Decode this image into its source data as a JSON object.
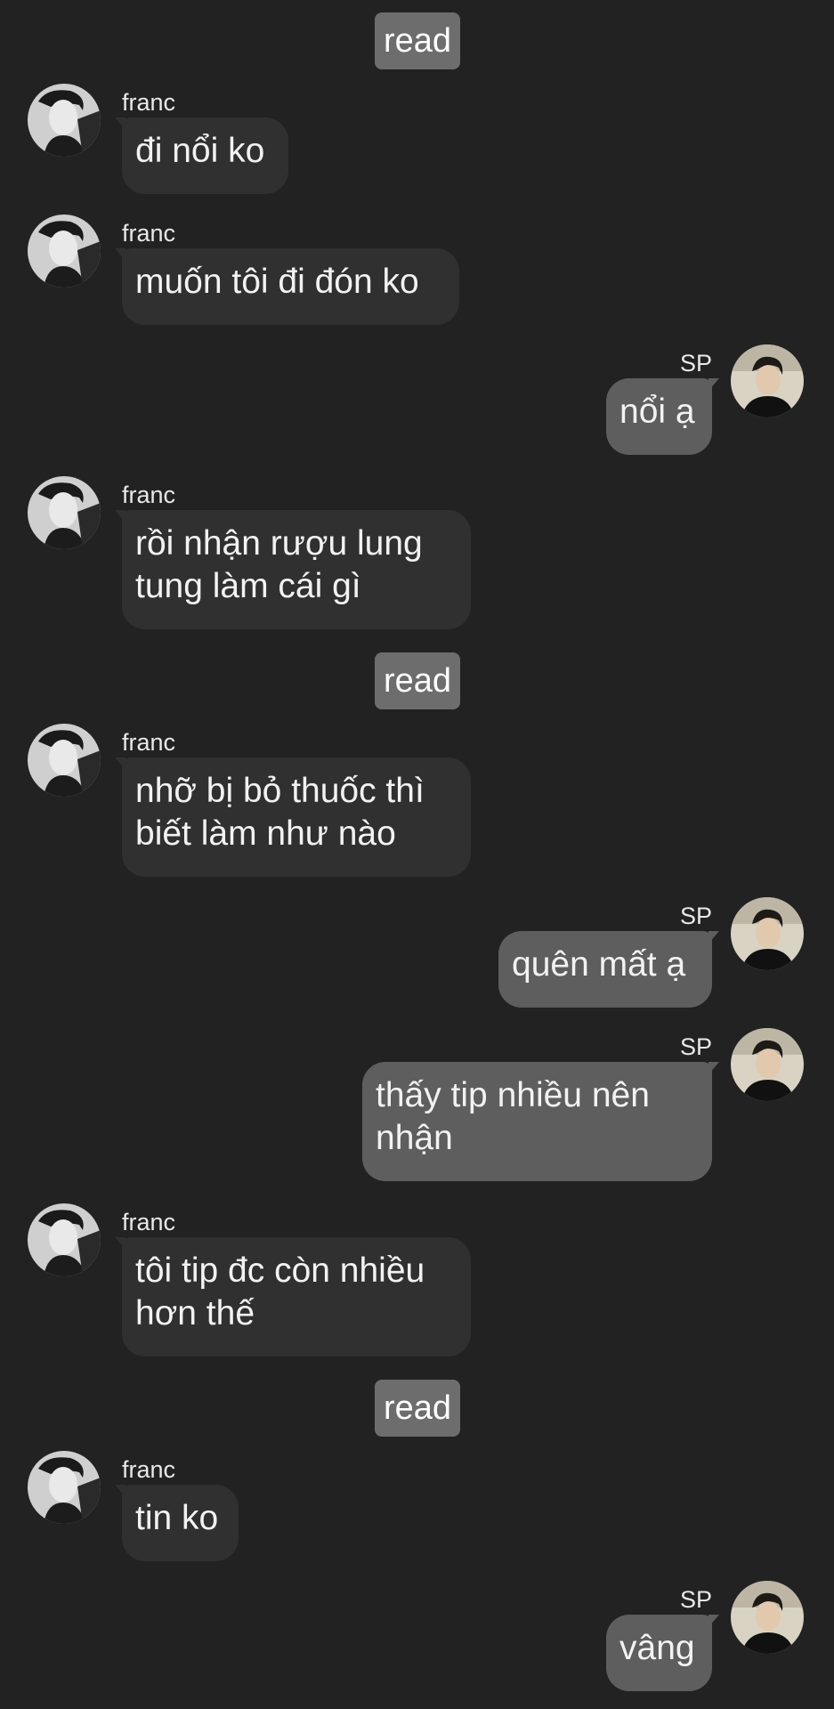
{
  "divider_label": "read",
  "users": {
    "franc": "franc",
    "sp": "SP"
  },
  "messages": [
    {
      "from": "franc",
      "text": "đi nổi ko"
    },
    {
      "from": "franc",
      "text": "muốn tôi đi đón ko"
    },
    {
      "from": "sp",
      "text": "nổi ạ"
    },
    {
      "from": "franc",
      "text": "rồi nhận rượu lung\ntung làm cái gì"
    },
    {
      "from": "franc",
      "text": "nhỡ bị bỏ thuốc thì\nbiết làm như nào"
    },
    {
      "from": "sp",
      "text": "quên mất ạ"
    },
    {
      "from": "sp",
      "text": "thấy tip nhiều nên\nnhận"
    },
    {
      "from": "franc",
      "text": "tôi tip đc còn nhiều\nhơn thế"
    },
    {
      "from": "franc",
      "text": "tin ko"
    },
    {
      "from": "sp",
      "text": "vâng"
    }
  ],
  "icons": {
    "franc_avatar": "avatar-franc-icon",
    "sp_avatar": "avatar-sp-icon"
  }
}
